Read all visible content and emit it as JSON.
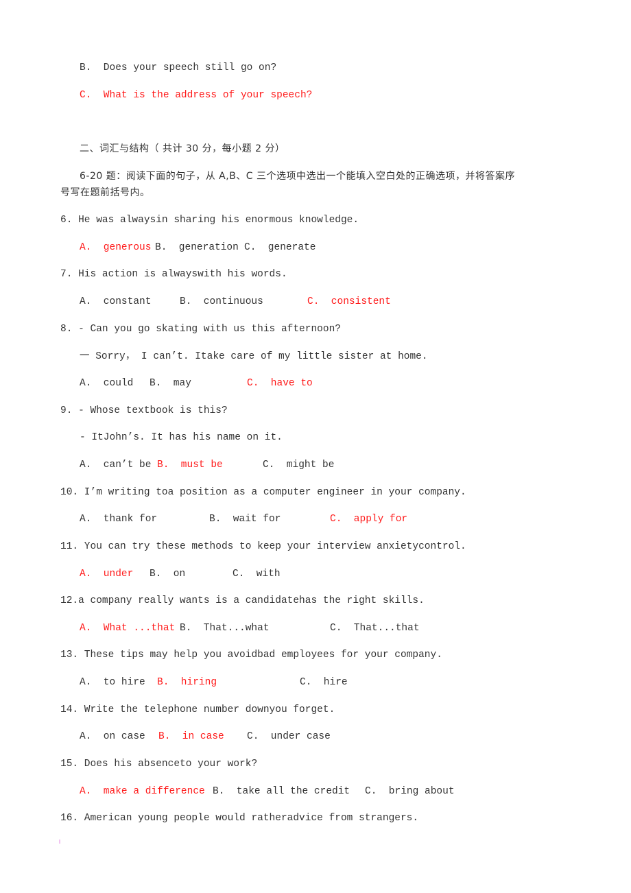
{
  "colors": {
    "text": "#333333",
    "answer": "#ff1a1a"
  },
  "prev_options": [
    {
      "text": "B.  Does your speech still go on?",
      "correct": false
    },
    {
      "text": "C.  What is the address of your speech?",
      "correct": true
    }
  ],
  "section": {
    "title": "二、词汇与结构（ 共计 30 分，每小题 2 分）",
    "instruction_line1": "6-20 题：阅读下面的句子，从 A,B、C 三个选项中选出一个能填入空白处的正确选项，并将答案序",
    "instruction_line2": "号写在题前括号内。"
  },
  "questions": [
    {
      "stem": "6. He was alwaysin sharing his enormous knowledge.",
      "options": [
        {
          "text": "A.  generous",
          "correct": true
        },
        {
          "text": "B.  generation",
          "correct": false
        },
        {
          "text": "C.  generate",
          "correct": false
        }
      ]
    },
    {
      "stem": "7. His action is alwayswith his words.",
      "options": [
        {
          "text": "A.  constant",
          "correct": false
        },
        {
          "text": "B.  continuous",
          "correct": false
        },
        {
          "text": "C.  consistent",
          "correct": true
        }
      ]
    },
    {
      "stem": "8. - Can you go skating with us this afternoon?",
      "stem2": "一 Sorry， I can’t. Itake care of my little sister at home.",
      "options": [
        {
          "text": "A.  could",
          "correct": false
        },
        {
          "text": "B.  may",
          "correct": false
        },
        {
          "text": "C.  have to",
          "correct": true
        }
      ]
    },
    {
      "stem": "9. - Whose textbook is this?",
      "stem2": "- ItJohn’s. It has his name on it.",
      "options": [
        {
          "text": "A.  can’t be",
          "correct": false
        },
        {
          "text": "B.  must be",
          "correct": true
        },
        {
          "text": "C.  might be",
          "correct": false
        }
      ]
    },
    {
      "stem": "10. I’m writing toa position as a computer engineer in your company.",
      "options": [
        {
          "text": "A.  thank for",
          "correct": false
        },
        {
          "text": "B.  wait for",
          "correct": false
        },
        {
          "text": "C.  apply for",
          "correct": true
        }
      ]
    },
    {
      "stem": "11. You can try these methods to keep your interview anxietycontrol.",
      "options": [
        {
          "text": "A.  under",
          "correct": true
        },
        {
          "text": "B.  on",
          "correct": false
        },
        {
          "text": "C.  with",
          "correct": false
        }
      ]
    },
    {
      "stem": "12.a company really wants is a candidatehas the right skills.",
      "options": [
        {
          "text": "A.  What ...that",
          "correct": true
        },
        {
          "text": "B.  That...what",
          "correct": false
        },
        {
          "text": "C.  That...that",
          "correct": false
        }
      ]
    },
    {
      "stem": "13. These tips may help you avoidbad employees for your company.",
      "options": [
        {
          "text": "A.  to hire",
          "correct": false
        },
        {
          "text": "B.  hiring",
          "correct": true
        },
        {
          "text": "C.  hire",
          "correct": false
        }
      ]
    },
    {
      "stem": "14. Write the telephone number downyou forget.",
      "options": [
        {
          "text": "A.  on case",
          "correct": false
        },
        {
          "text": "B.  in case",
          "correct": true
        },
        {
          "text": "C.  under case",
          "correct": false
        }
      ]
    },
    {
      "stem": "15. Does his absenceto your work?",
      "options": [
        {
          "text": "A.  make a difference",
          "correct": true
        },
        {
          "text": "B.  take all the credit",
          "correct": false
        },
        {
          "text": "C.  bring about",
          "correct": false
        }
      ]
    },
    {
      "stem": "16. American young people would ratheradvice from strangers."
    }
  ]
}
